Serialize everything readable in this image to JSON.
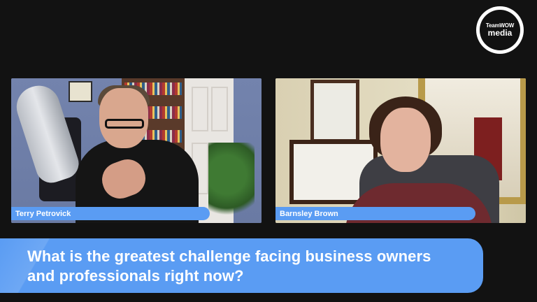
{
  "logo": {
    "line1": "TeamWOW",
    "line2": "media"
  },
  "participants": [
    {
      "name": "Terry Petrovick"
    },
    {
      "name": "Barnsley Brown"
    }
  ],
  "banner": {
    "question": "What is the greatest challenge facing business owners and professionals right now?"
  },
  "colors": {
    "background": "#121212",
    "accent": "#5a9cf3",
    "text_on_accent": "#ffffff"
  }
}
